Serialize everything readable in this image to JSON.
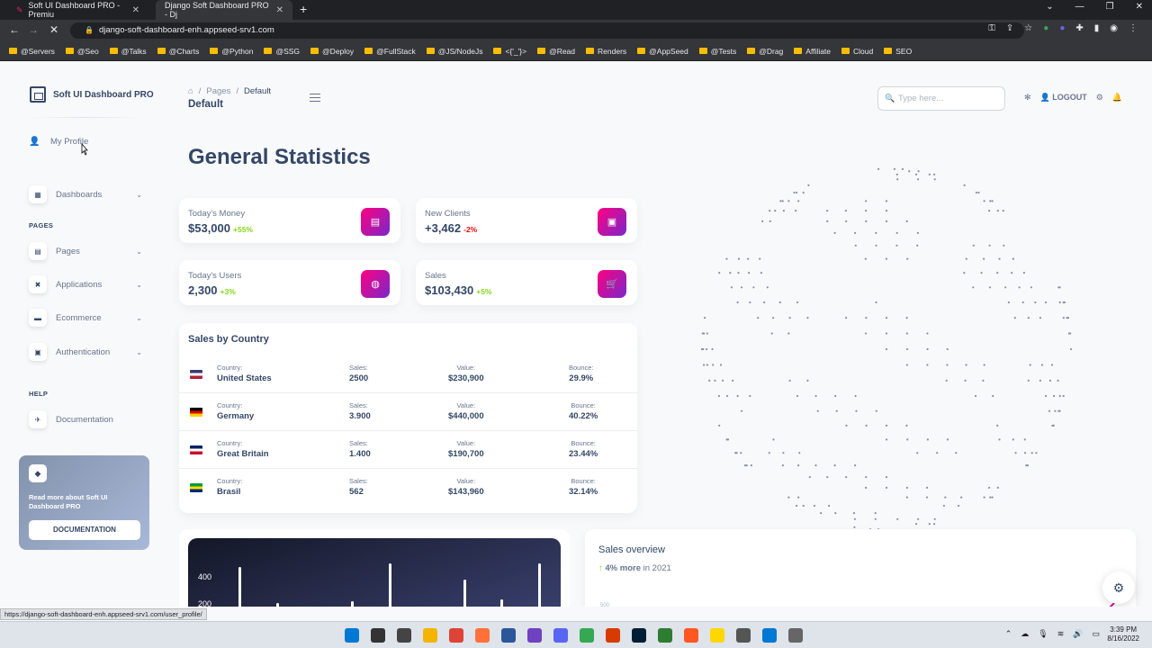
{
  "browser": {
    "tabs": [
      {
        "title": "Soft UI Dashboard PRO - Premiu",
        "active": false
      },
      {
        "title": "Django Soft Dashboard PRO - Dj",
        "active": true
      }
    ],
    "url": "django-soft-dashboard-enh.appseed-srv1.com",
    "bookmarks": [
      "@Servers",
      "@Seo",
      "@Talks",
      "@Charts",
      "@Python",
      "@SSG",
      "@Deploy",
      "@FullStack",
      "@JS/NodeJs",
      "<{'_'}>",
      "@Read",
      "Renders",
      "@AppSeed",
      "@Tests",
      "@Drag",
      "Affiliate",
      "Cloud",
      "SEO"
    ],
    "status_url": "https://django-soft-dashboard-enh.appseed-srv1.com/user_profile/"
  },
  "sidebar": {
    "brand": "Soft UI Dashboard PRO",
    "profile": "My Profile",
    "dashboards": "Dashboards",
    "section_pages": "PAGES",
    "items": [
      "Pages",
      "Applications",
      "Ecommerce",
      "Authentication"
    ],
    "section_help": "HELP",
    "documentation": "Documentation",
    "card": {
      "text": "Read more about Soft UI Dashboard PRO",
      "button": "DOCUMENTATION"
    }
  },
  "topbar": {
    "crumb_parent": "Pages",
    "crumb_current": "Default",
    "title": "Default",
    "search_placeholder": "Type here...",
    "logout": "LOGOUT"
  },
  "main": {
    "heading": "General Statistics",
    "stats": [
      {
        "label": "Today's Money",
        "value": "$53,000",
        "change": "+55%",
        "positive": true
      },
      {
        "label": "New Clients",
        "value": "+3,462",
        "change": "-2%",
        "positive": false
      },
      {
        "label": "Today's Users",
        "value": "2,300",
        "change": "+3%",
        "positive": true
      },
      {
        "label": "Sales",
        "value": "$103,430",
        "change": "+5%",
        "positive": true
      }
    ],
    "sales_by_country": {
      "title": "Sales by Country",
      "headers": {
        "country": "Country:",
        "sales": "Sales:",
        "value": "Value:",
        "bounce": "Bounce:"
      },
      "rows": [
        {
          "country": "United States",
          "sales": "2500",
          "value": "$230,900",
          "bounce": "29.9%"
        },
        {
          "country": "Germany",
          "sales": "3.900",
          "value": "$440,000",
          "bounce": "40.22%"
        },
        {
          "country": "Great Britain",
          "sales": "1.400",
          "value": "$190,700",
          "bounce": "23.44%"
        },
        {
          "country": "Brasil",
          "sales": "562",
          "value": "$143,960",
          "bounce": "32.14%"
        }
      ]
    },
    "bar_chart": {
      "y_ticks": [
        "400",
        "200"
      ]
    },
    "sales_overview": {
      "title": "Sales overview",
      "change": "4% more",
      "period": "in 2021",
      "tick": "500"
    }
  },
  "taskbar": {
    "time": "3:39 PM",
    "date": "8/16/2022"
  }
}
